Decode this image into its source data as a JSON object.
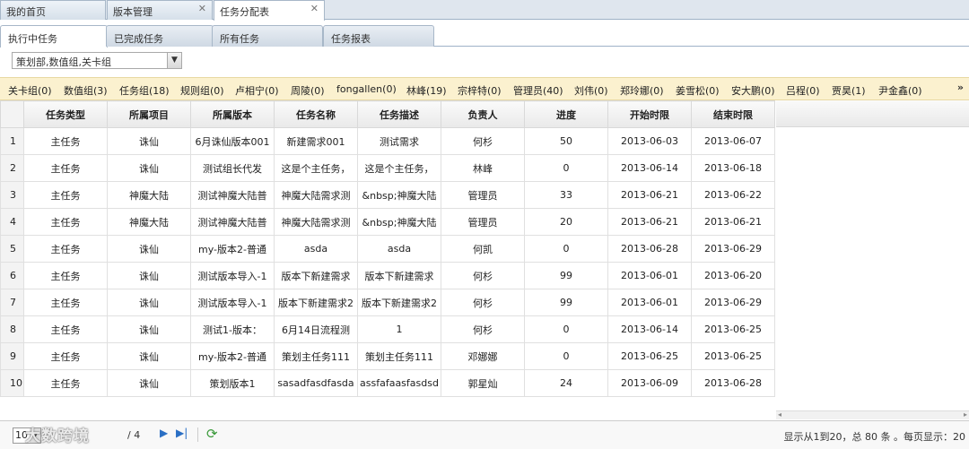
{
  "top_tabs": [
    {
      "label": "我的首页"
    },
    {
      "label": "版本管理",
      "closable": true
    },
    {
      "label": "任务分配表",
      "closable": true,
      "active": true
    }
  ],
  "close_glyph": "✕",
  "sub_tabs": [
    {
      "label": "执行中任务",
      "active": true
    },
    {
      "label": "已完成任务"
    },
    {
      "label": "所有任务"
    },
    {
      "label": "任务报表"
    }
  ],
  "selector": {
    "value": "策划部,数值组,关卡组",
    "icon": "chevron-down-icon"
  },
  "filters": [
    "关卡组(0)",
    "数值组(3)",
    "任务组(18)",
    "规则组(0)",
    "卢相宁(0)",
    "周陵(0)",
    "fongallen(0)",
    "林峰(19)",
    "宗梓特(0)",
    "管理员(40)",
    "刘伟(0)",
    "郑玲娜(0)",
    "姜雪松(0)",
    "安大鹏(0)",
    "吕程(0)",
    "贾昊(1)",
    "尹金鑫(0)"
  ],
  "filter_more_glyph": "»",
  "table": {
    "headers": [
      "任务类型",
      "所属项目",
      "所属版本",
      "任务名称",
      "任务描述",
      "负责人",
      "进度",
      "开始时限",
      "结束时限"
    ],
    "rows": [
      [
        "1",
        "主任务",
        "诛仙",
        "6月诛仙版本001",
        "新建需求001",
        "测试需求",
        "何杉",
        "50",
        "2013-06-03",
        "2013-06-07"
      ],
      [
        "2",
        "主任务",
        "诛仙",
        "测试组长代发",
        "这是个主任务，",
        "这是个主任务，",
        "林峰",
        "0",
        "2013-06-14",
        "2013-06-18"
      ],
      [
        "3",
        "主任务",
        "神魔大陆",
        "测试神魔大陆普",
        "神魔大陆需求测",
        "&nbsp;神魔大陆",
        "管理员",
        "33",
        "2013-06-21",
        "2013-06-22"
      ],
      [
        "4",
        "主任务",
        "神魔大陆",
        "测试神魔大陆普",
        "神魔大陆需求测",
        "&nbsp;神魔大陆",
        "管理员",
        "20",
        "2013-06-21",
        "2013-06-21"
      ],
      [
        "5",
        "主任务",
        "诛仙",
        "my-版本2-普通",
        "asda",
        "asda",
        "何凯",
        "0",
        "2013-06-28",
        "2013-06-29"
      ],
      [
        "6",
        "主任务",
        "诛仙",
        "测试版本导入-1",
        "版本下新建需求",
        "版本下新建需求",
        "何杉",
        "99",
        "2013-06-01",
        "2013-06-20"
      ],
      [
        "7",
        "主任务",
        "诛仙",
        "测试版本导入-1",
        "版本下新建需求2",
        "版本下新建需求2",
        "何杉",
        "99",
        "2013-06-01",
        "2013-06-29"
      ],
      [
        "8",
        "主任务",
        "诛仙",
        "测试1-版本：",
        "6月14日流程测",
        "1",
        "何杉",
        "0",
        "2013-06-14",
        "2013-06-25"
      ],
      [
        "9",
        "主任务",
        "诛仙",
        "my-版本2-普通",
        "策划主任务111",
        "策划主任务111",
        "邓娜娜",
        "0",
        "2013-06-25",
        "2013-06-25"
      ],
      [
        "10",
        "主任务",
        "诛仙",
        "策划版本1",
        "sasadfasdfasda",
        "assfafaasfasdsd",
        "郭星灿",
        "24",
        "2013-06-09",
        "2013-06-28"
      ]
    ]
  },
  "pager": {
    "page_size": "10",
    "total_pages": "/ 4",
    "watermark": "大数跨境",
    "next_glyph": "▶",
    "last_glyph": "▶|",
    "refresh_glyph": "⟳",
    "info": "显示从1到20，总 80 条 。每页显示：20",
    "scroll_left": "◂",
    "scroll_right": "▸"
  }
}
